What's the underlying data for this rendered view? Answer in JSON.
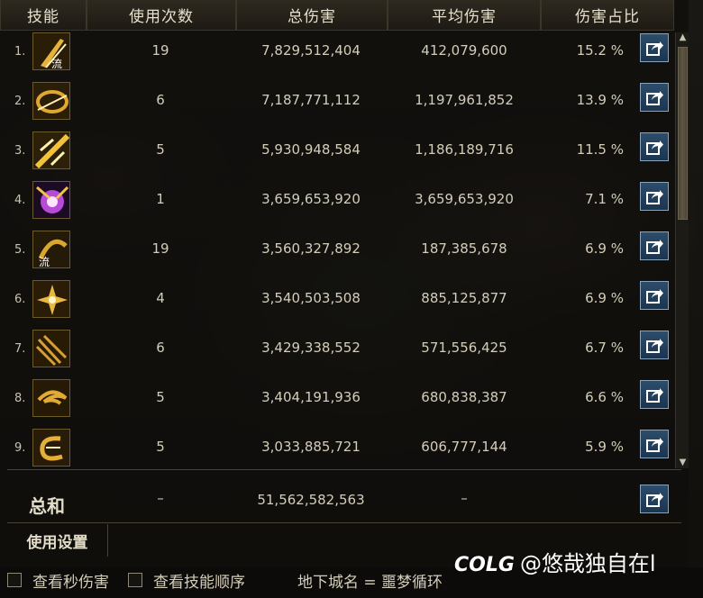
{
  "header": {
    "col_skill": "技能",
    "col_uses": "使用次数",
    "col_total": "总伤害",
    "col_avg": "平均伤害",
    "col_pct": "伤害占比"
  },
  "rows": [
    {
      "rank": "1.",
      "uses": "19",
      "total": "7,829,512,404",
      "avg": "412,079,600",
      "pct": "15.2 %",
      "icon_name": "sword-slash-icon",
      "icon_color": "#e8b23a"
    },
    {
      "rank": "2.",
      "uses": "6",
      "total": "7,187,771,112",
      "avg": "1,197,961,852",
      "pct": "13.9 %",
      "icon_name": "spiral-blade-icon",
      "icon_color": "#e0a830"
    },
    {
      "rank": "3.",
      "uses": "5",
      "total": "5,930,948,584",
      "avg": "1,186,189,716",
      "pct": "11.5 %",
      "icon_name": "burst-strike-icon",
      "icon_color": "#f2c23a"
    },
    {
      "rank": "4.",
      "uses": "1",
      "total": "3,659,653,920",
      "avg": "3,659,653,920",
      "pct": "7.1 %",
      "icon_name": "purple-explosion-icon",
      "icon_color": "#b84ad8"
    },
    {
      "rank": "5.",
      "uses": "19",
      "total": "3,560,327,892",
      "avg": "187,385,678",
      "pct": "6.9 %",
      "icon_name": "flow-crescent-icon",
      "icon_color": "#d9a62e"
    },
    {
      "rank": "6.",
      "uses": "4",
      "total": "3,540,503,508",
      "avg": "885,125,877",
      "pct": "6.9 %",
      "icon_name": "star-burst-icon",
      "icon_color": "#e8b840"
    },
    {
      "rank": "7.",
      "uses": "6",
      "total": "3,429,338,552",
      "avg": "571,556,425",
      "pct": "6.7 %",
      "icon_name": "multi-slash-icon",
      "icon_color": "#d8a030"
    },
    {
      "rank": "8.",
      "uses": "5",
      "total": "3,404,191,936",
      "avg": "680,838,387",
      "pct": "6.6 %",
      "icon_name": "wind-swirl-icon",
      "icon_color": "#e0aa34"
    },
    {
      "rank": "9.",
      "uses": "5",
      "total": "3,033,885,721",
      "avg": "606,777,144",
      "pct": "5.9 %",
      "icon_name": "crescent-wave-icon",
      "icon_color": "#e4b03a"
    }
  ],
  "icon_glyph_flow": "流",
  "summary": {
    "label": "总和",
    "uses": "–",
    "total": "51,562,582,563",
    "avg": "–"
  },
  "settings": {
    "label": "使用设置"
  },
  "footer": {
    "view_second_damage": "查看秒伤害",
    "view_skill_order": "查看技能顺序",
    "dungeon": "地下城名 = 噩梦循环"
  },
  "watermark": {
    "logo": "COLG",
    "text": "@悠哉独自在l"
  },
  "colors": {
    "share_button": "#1f3d5c",
    "header_bg": "#2a2519",
    "text": "#d4cdb9"
  }
}
